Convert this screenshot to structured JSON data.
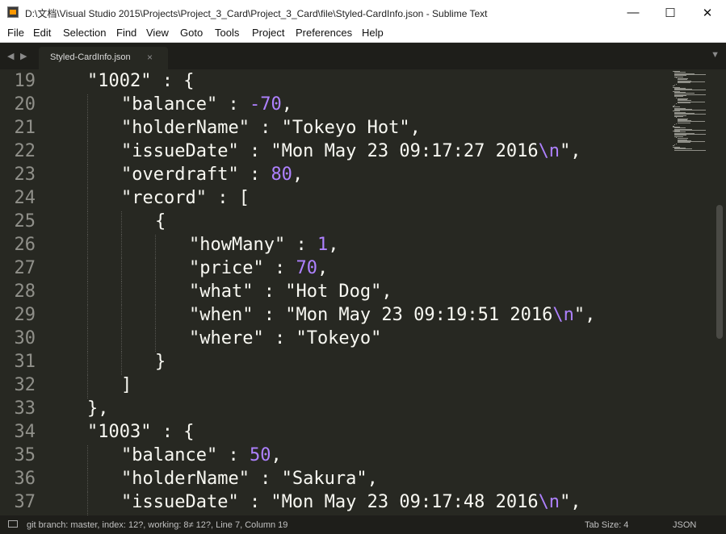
{
  "window": {
    "title": "D:\\文档\\Visual Studio 2015\\Projects\\Project_3_Card\\Project_3_Card\\file\\Styled-CardInfo.json - Sublime Text",
    "minimize_glyph": "—",
    "maximize_glyph": "☐",
    "close_glyph": "✕"
  },
  "menu": [
    "File",
    "Edit",
    "Selection",
    "Find",
    "View",
    "Goto",
    "Tools",
    "Project",
    "Preferences",
    "Help"
  ],
  "tabs": {
    "back_glyph": "◀",
    "forward_glyph": "▶",
    "active": "Styled-CardInfo.json",
    "close_glyph": "×",
    "menu_glyph": "▼"
  },
  "editor": {
    "colors": {
      "background": "#272822",
      "text": "#f8f8f2",
      "number": "#ae81ff",
      "line_number": "#90908a"
    },
    "lines": [
      {
        "num": "19",
        "indent": 1,
        "parts": [
          {
            "t": "\"1002\" : {"
          }
        ]
      },
      {
        "num": "20",
        "indent": 2,
        "parts": [
          {
            "t": "\"balance\" : "
          },
          {
            "t": "-70",
            "c": "num"
          },
          {
            "t": ","
          }
        ]
      },
      {
        "num": "21",
        "indent": 2,
        "parts": [
          {
            "t": "\"holderName\" : \"Tokeyo Hot\","
          }
        ]
      },
      {
        "num": "22",
        "indent": 2,
        "parts": [
          {
            "t": "\"issueDate\" : \"Mon May 23 09:17:27 2016"
          },
          {
            "t": "\\n",
            "c": "esc"
          },
          {
            "t": "\","
          }
        ]
      },
      {
        "num": "23",
        "indent": 2,
        "parts": [
          {
            "t": "\"overdraft\" : "
          },
          {
            "t": "80",
            "c": "num"
          },
          {
            "t": ","
          }
        ]
      },
      {
        "num": "24",
        "indent": 2,
        "parts": [
          {
            "t": "\"record\" : ["
          }
        ]
      },
      {
        "num": "25",
        "indent": 3,
        "parts": [
          {
            "t": "{"
          }
        ]
      },
      {
        "num": "26",
        "indent": 4,
        "parts": [
          {
            "t": "\"howMany\" : "
          },
          {
            "t": "1",
            "c": "num"
          },
          {
            "t": ","
          }
        ]
      },
      {
        "num": "27",
        "indent": 4,
        "parts": [
          {
            "t": "\"price\" : "
          },
          {
            "t": "70",
            "c": "num"
          },
          {
            "t": ","
          }
        ]
      },
      {
        "num": "28",
        "indent": 4,
        "parts": [
          {
            "t": "\"what\" : \"Hot Dog\","
          }
        ]
      },
      {
        "num": "29",
        "indent": 4,
        "parts": [
          {
            "t": "\"when\" : \"Mon May 23 09:19:51 2016"
          },
          {
            "t": "\\n",
            "c": "esc"
          },
          {
            "t": "\","
          }
        ]
      },
      {
        "num": "30",
        "indent": 4,
        "parts": [
          {
            "t": "\"where\" : \"Tokeyo\""
          }
        ]
      },
      {
        "num": "31",
        "indent": 3,
        "parts": [
          {
            "t": "}"
          }
        ]
      },
      {
        "num": "32",
        "indent": 2,
        "parts": [
          {
            "t": "]"
          }
        ]
      },
      {
        "num": "33",
        "indent": 1,
        "parts": [
          {
            "t": "},"
          }
        ]
      },
      {
        "num": "34",
        "indent": 1,
        "parts": [
          {
            "t": "\"1003\" : {"
          }
        ]
      },
      {
        "num": "35",
        "indent": 2,
        "parts": [
          {
            "t": "\"balance\" : "
          },
          {
            "t": "50",
            "c": "num"
          },
          {
            "t": ","
          }
        ]
      },
      {
        "num": "36",
        "indent": 2,
        "parts": [
          {
            "t": "\"holderName\" : \"Sakura\","
          }
        ]
      },
      {
        "num": "37",
        "indent": 2,
        "parts": [
          {
            "t": "\"issueDate\" : \"Mon May 23 09:17:48 2016"
          },
          {
            "t": "\\n",
            "c": "esc"
          },
          {
            "t": "\","
          }
        ]
      }
    ]
  },
  "status": {
    "left": "git branch: master, index: 12?, working: 8≠ 12?, Line 7, Column 19",
    "tab_size": "Tab Size: 4",
    "syntax": "JSON"
  }
}
